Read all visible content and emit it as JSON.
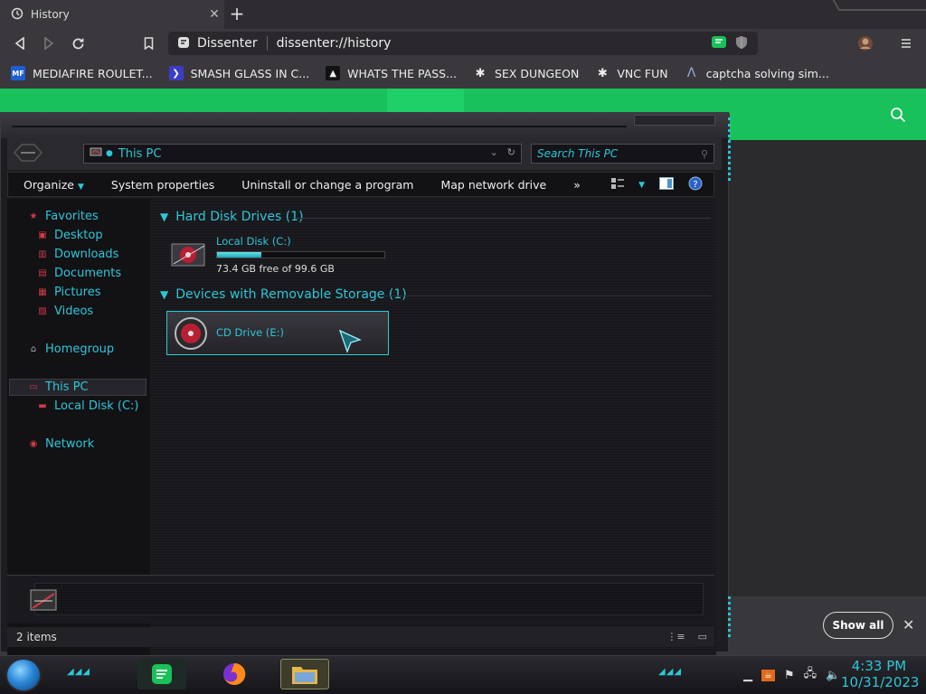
{
  "browser": {
    "tab_title": "History",
    "tab_close": "✕",
    "new_tab": "+",
    "site_name": "Dissenter",
    "url": "dissenter://history",
    "bookmarks": [
      {
        "label": "MEDIAFIRE ROULET...",
        "icon": "mediafire-icon"
      },
      {
        "label": "SMASH GLASS IN C...",
        "icon": "bookmark-chevron-icon"
      },
      {
        "label": "WHATS THE PASS...",
        "icon": "bookmark-black-icon"
      },
      {
        "label": "SEX DUNGEON",
        "icon": "bookmark-spider-icon"
      },
      {
        "label": "VNC FUN",
        "icon": "bookmark-spider-icon"
      },
      {
        "label": "captcha solving sim...",
        "icon": "bookmark-a-icon"
      }
    ]
  },
  "explorer": {
    "address_path": "This PC",
    "search_placeholder": "Search This PC",
    "commands": [
      {
        "label": "Organize",
        "has_dropdown": true
      },
      {
        "label": "System properties"
      },
      {
        "label": "Uninstall or change a program"
      },
      {
        "label": "Map network drive"
      },
      {
        "label": "»"
      }
    ],
    "nav": {
      "favorites": "Favorites",
      "desktop": "Desktop",
      "downloads": "Downloads",
      "documents": "Documents",
      "pictures": "Pictures",
      "videos": "Videos",
      "homegroup": "Homegroup",
      "this_pc": "This PC",
      "local_disk": "Local Disk (C:)",
      "network": "Network"
    },
    "groups": {
      "hard_disk": "Hard Disk Drives (1)",
      "removable": "Devices with Removable Storage (1)"
    },
    "drives": {
      "c_name": "Local Disk (C:)",
      "c_free_text": "73.4 GB free of 99.6 GB",
      "c_used_fraction": 0.263,
      "e_name": "CD Drive (E:)"
    },
    "status": "2 items"
  },
  "downloads_bar": {
    "show_all": "Show all",
    "close": "✕"
  },
  "taskbar": {
    "time": "4:33 PM",
    "date": "10/31/2023"
  },
  "colors": {
    "accent_cyan": "#2cc7d8",
    "brand_green": "#18c15a"
  }
}
